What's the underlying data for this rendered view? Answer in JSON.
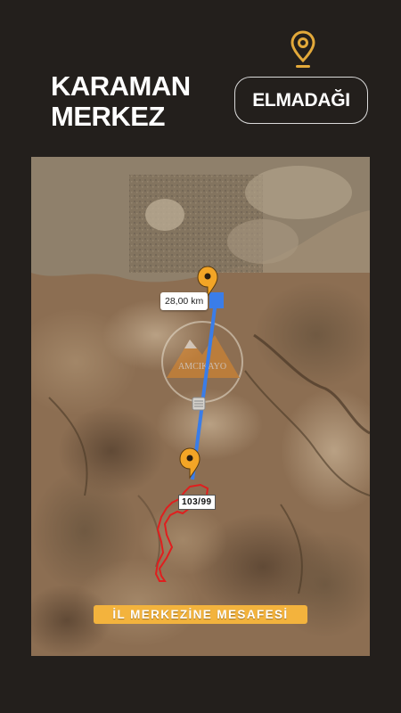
{
  "header": {
    "city_line_1": "KARAMAN",
    "city_line_2": "MERKEZ",
    "district": "ELMADAĞI",
    "pin_icon": "location-pin-icon"
  },
  "map": {
    "distance": "28,00 km",
    "parcel": "103/99",
    "banner": "İL MERKEZİNE MESAFESİ",
    "watermark_icon": "mountain-logo-icon",
    "route_color": "#3a7de8",
    "parcel_outline_color": "#e01e1e",
    "pin_color": "#f3a526"
  },
  "colors": {
    "background": "#231f1c",
    "accent": "#f3b33d",
    "text": "#ffffff"
  }
}
